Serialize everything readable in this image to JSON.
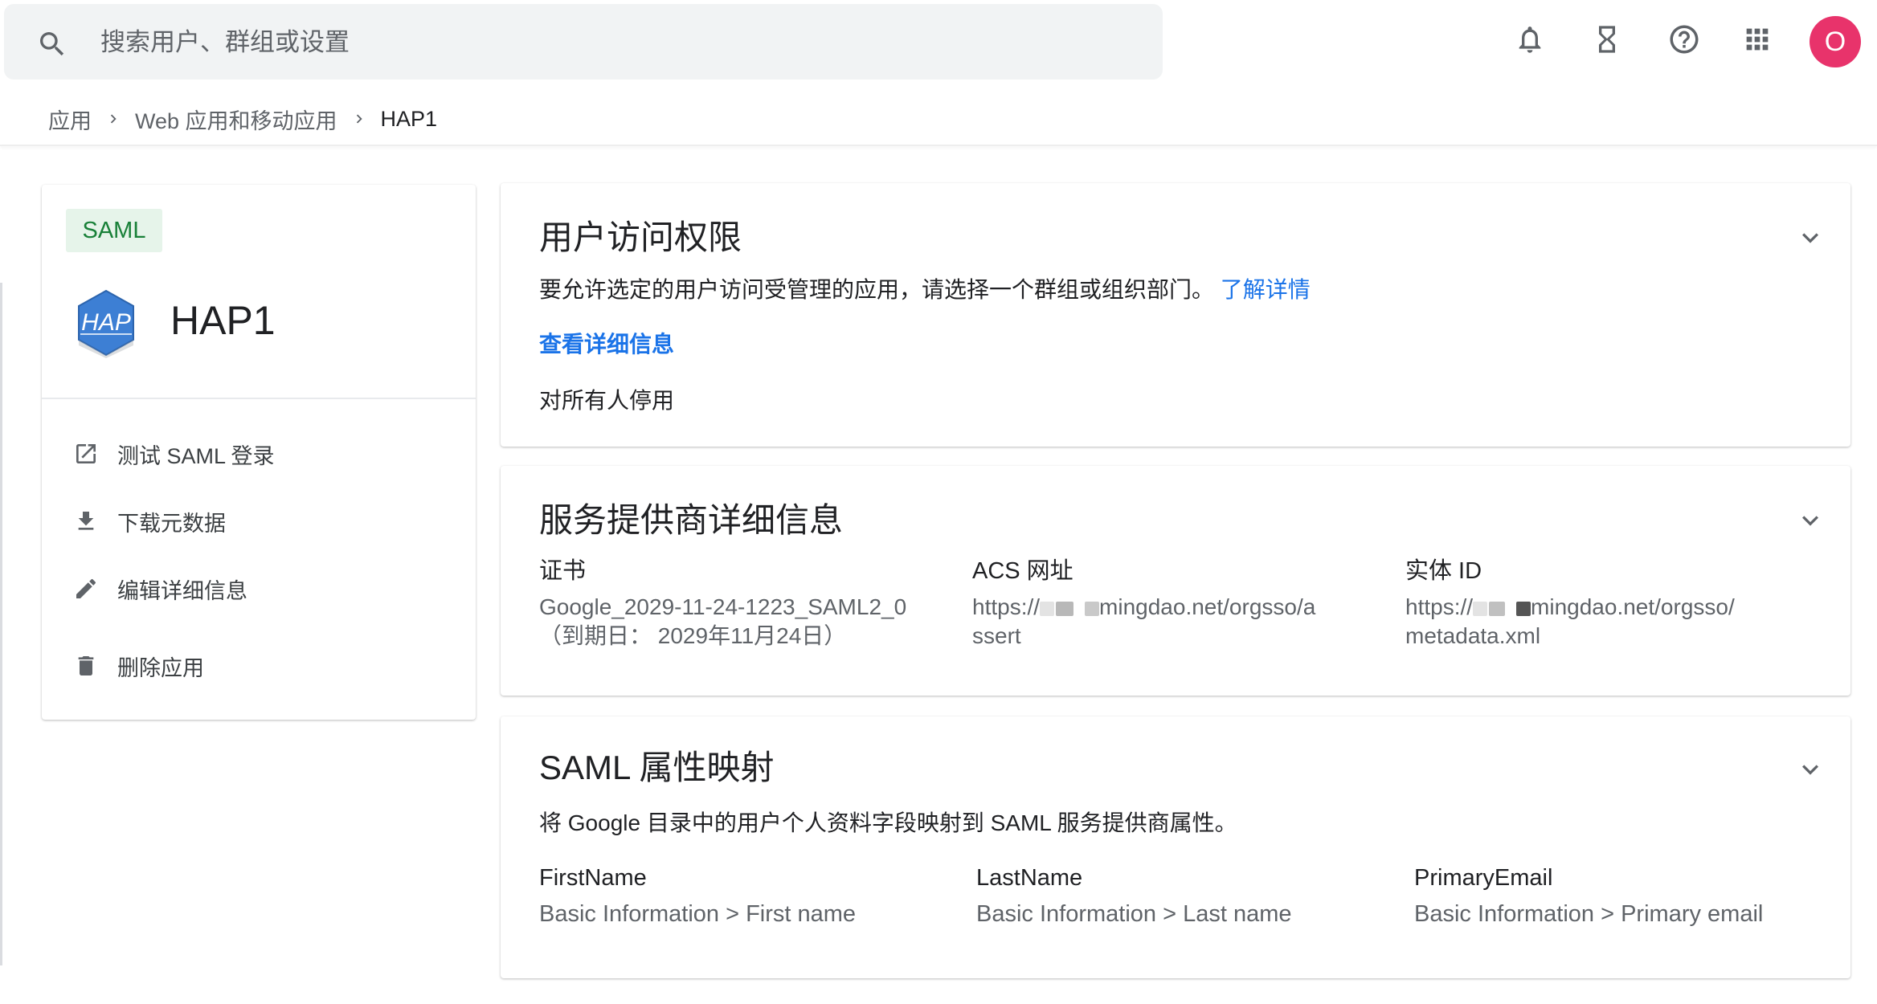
{
  "search": {
    "placeholder": "搜索用户、群组或设置"
  },
  "topbar": {
    "icons": [
      "notifications-icon",
      "hourglass-icon",
      "help-icon",
      "apps-grid-icon"
    ],
    "avatar_initial": "O",
    "avatar_color": "#e8336b"
  },
  "breadcrumb": {
    "items": [
      "应用",
      "Web 应用和移动应用",
      "HAP1"
    ]
  },
  "app": {
    "badge": "SAML",
    "logo_text": "HAP",
    "name": "HAP1",
    "actions": [
      {
        "label": "测试 SAML 登录",
        "icon": "open-in-new-icon"
      },
      {
        "label": "下载元数据",
        "icon": "download-icon"
      },
      {
        "label": "编辑详细信息",
        "icon": "edit-pencil-icon"
      },
      {
        "label": "删除应用",
        "icon": "trash-icon"
      }
    ]
  },
  "user_access": {
    "title": "用户访问权限",
    "description": "要允许选定的用户访问受管理的应用，请选择一个群组或组织部门。",
    "learn_more": "了解详情",
    "view_details": "查看详细信息",
    "status": "对所有人停用"
  },
  "service_provider": {
    "title": "服务提供商详细信息",
    "certificate": {
      "label": "证书",
      "value_line1": "Google_2029-11-24-1223_SAML2_0",
      "value_line2": "（到期日： 2029年11月24日）"
    },
    "acs_url": {
      "label": "ACS 网址",
      "value_prefix": "https://",
      "value_suffix": "mingdao.net/orgsso/a",
      "value_line2": "ssert"
    },
    "entity_id": {
      "label": "实体 ID",
      "value_prefix": "https://",
      "value_suffix": "mingdao.net/orgsso/",
      "value_line2": "metadata.xml"
    }
  },
  "attribute_mapping": {
    "title": "SAML 属性映射",
    "description": "将 Google 目录中的用户个人资料字段映射到 SAML 服务提供商属性。",
    "columns": [
      {
        "name": "FirstName",
        "mapping": "Basic Information > First name"
      },
      {
        "name": "LastName",
        "mapping": "Basic Information > Last name"
      },
      {
        "name": "PrimaryEmail",
        "mapping": "Basic Information > Primary email"
      }
    ]
  },
  "colors": {
    "link": "#1a73e8",
    "badge_bg": "#e6f4ea",
    "badge_text": "#188038",
    "logo_blue": "#3d7fd4"
  }
}
